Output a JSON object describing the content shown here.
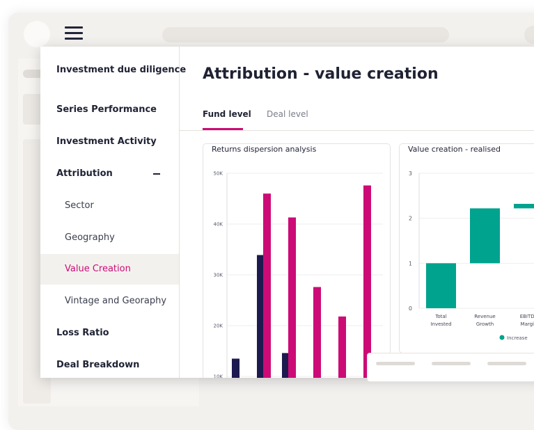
{
  "sidebar": {
    "title": "Investment due diligence",
    "items": [
      {
        "label": "Series Performance",
        "level": "top"
      },
      {
        "label": "Investment Activity",
        "level": "top"
      },
      {
        "label": "Attribution",
        "level": "top",
        "expanded": true
      },
      {
        "label": "Sector",
        "level": "sub"
      },
      {
        "label": "Geography",
        "level": "sub"
      },
      {
        "label": "Value Creation",
        "level": "sub",
        "active": true
      },
      {
        "label": "Vintage and Georaphy",
        "level": "sub"
      },
      {
        "label": "Loss Ratio",
        "level": "top"
      },
      {
        "label": "Deal Breakdown",
        "level": "top"
      }
    ]
  },
  "main": {
    "title": "Attribution - value creation",
    "tabs": [
      {
        "label": "Fund level",
        "active": true
      },
      {
        "label": "Deal level",
        "active": false
      }
    ]
  },
  "colors": {
    "accent": "#cc0b76",
    "navy": "#1c1a4e",
    "teal": "#00a38e",
    "text": "#1f2233"
  },
  "chart_data": [
    {
      "type": "bar",
      "title": "Returns dispersion analysis",
      "y_ticks": [
        "50K",
        "40K",
        "30K",
        "20K",
        "10K"
      ],
      "ylim": [
        10000,
        50000
      ],
      "series": [
        {
          "color": "#1c1a4e",
          "values": [
            13500,
            33900,
            14600,
            null,
            null,
            null
          ]
        },
        {
          "color": "#cc0b76",
          "values": [
            null,
            46000,
            41300,
            27600,
            21800,
            47600
          ]
        }
      ]
    },
    {
      "type": "bar",
      "title": "Value creation - realised",
      "y_ticks": [
        "3",
        "2",
        "1",
        "0"
      ],
      "ylim": [
        0,
        3
      ],
      "categories": [
        "Total Invested",
        "Revenue Growth",
        "EBITDA Margin"
      ],
      "category_lines": [
        [
          "Total",
          "Invested"
        ],
        [
          "Revenue",
          "Growth"
        ],
        [
          "EBITDA",
          "Margin"
        ]
      ],
      "values": [
        {
          "base": 0,
          "top": 1.0
        },
        {
          "base": 1.0,
          "top": 2.22
        },
        {
          "base": 2.22,
          "top": 2.32
        }
      ],
      "legend": [
        {
          "label": "Increase",
          "color": "#00a38e"
        }
      ]
    }
  ]
}
